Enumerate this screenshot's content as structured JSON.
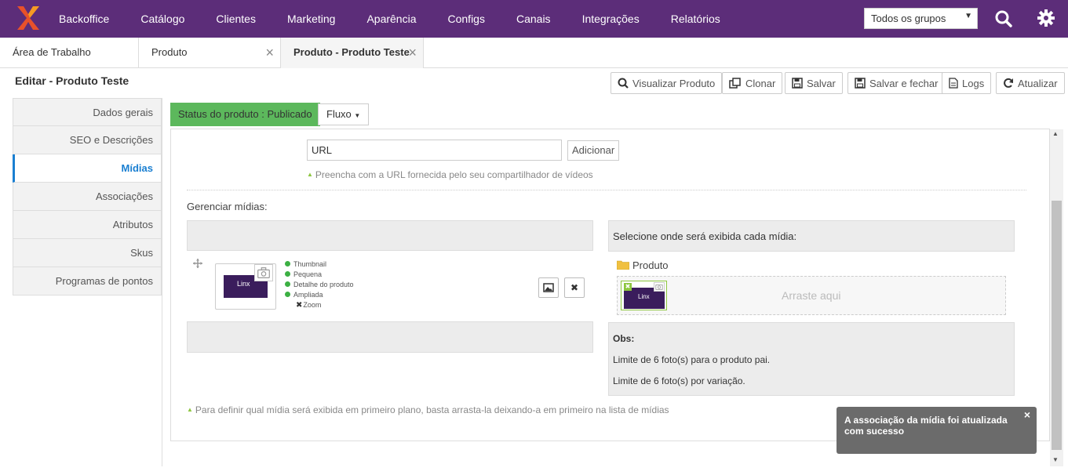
{
  "nav": {
    "items": [
      "Backoffice",
      "Catálogo",
      "Clientes",
      "Marketing",
      "Aparência",
      "Configs",
      "Canais",
      "Integrações",
      "Relatórios"
    ],
    "group_select": "Todos os grupos",
    "colors": {
      "bar": "#5c2d79",
      "logo": "#e8512a"
    }
  },
  "tabs": [
    {
      "label": "Área de Trabalho"
    },
    {
      "label": "Produto",
      "close": "×"
    },
    {
      "label": "Produto - Produto Teste",
      "close": "×"
    }
  ],
  "header": {
    "title": "Editar - Produto Teste",
    "buttons": {
      "view": "Visualizar Produto",
      "clone": "Clonar",
      "save": "Salvar",
      "save_close": "Salvar e fechar",
      "logs": "Logs",
      "refresh": "Atualizar"
    }
  },
  "sidebar": {
    "items": [
      {
        "label": "Dados gerais"
      },
      {
        "label": "SEO e Descrições"
      },
      {
        "label": "Mídias",
        "active": true
      },
      {
        "label": "Associações"
      },
      {
        "label": "Atributos"
      },
      {
        "label": "Skus"
      },
      {
        "label": "Programas de pontos"
      }
    ],
    "active_color": "#1a7fd1"
  },
  "status": {
    "badge": "Status do produto : Publicado",
    "badge_color": "#5cb85c",
    "flow_button": "Fluxo"
  },
  "url_section": {
    "input_value": "URL",
    "add_button": "Adicionar",
    "hint": "Preencha com a URL fornecida pelo seu compartilhador de vídeos"
  },
  "manage": {
    "label": "Gerenciar mídias:",
    "thumb_label": "Linx",
    "tags": [
      "Thumbnail",
      "Pequena",
      "Detalhe do produto",
      "Ampliada"
    ],
    "zoom_label": "Zoom",
    "delete_symbol": "✖",
    "bottom_hint": "Para definir qual mídia será exibida em primeiro plano, basta arrasta-la deixando-a em primeiro na lista de mídias"
  },
  "select_panel": {
    "title": "Selecione onde será exibida cada mídia:",
    "folder": "Produto",
    "drop_text": "Arraste aqui",
    "thumb_label": "Linx",
    "obs_label": "Obs:",
    "obs_lines": [
      "Limite de 6 foto(s) para o produto pai.",
      "Limite de 6 foto(s) por variação."
    ]
  },
  "toast": {
    "message": "A associação da mídia foi atualizada com sucesso",
    "close": "×"
  }
}
